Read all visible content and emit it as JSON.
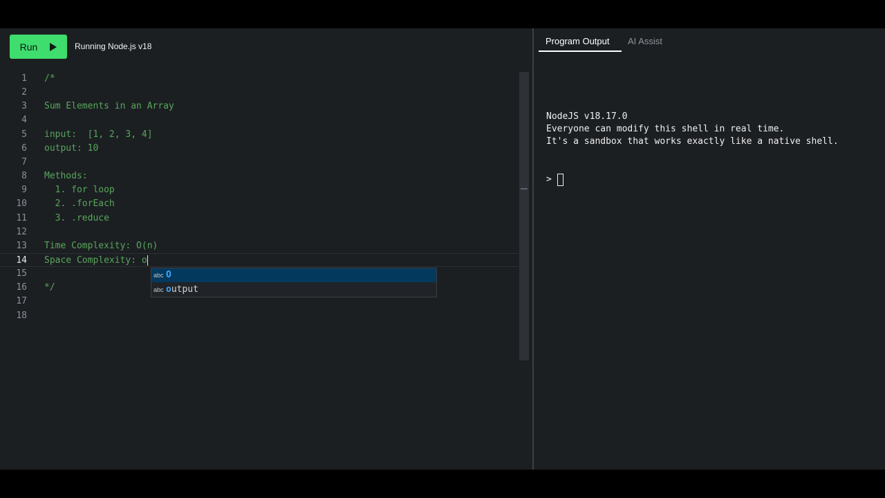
{
  "toolbar": {
    "run_label": "Run",
    "status": "Running Node.js v18"
  },
  "editor": {
    "current_line": 14,
    "lines": [
      {
        "n": "1",
        "text": "/*"
      },
      {
        "n": "2",
        "text": ""
      },
      {
        "n": "3",
        "text": "Sum Elements in an Array"
      },
      {
        "n": "4",
        "text": ""
      },
      {
        "n": "5",
        "text": "input:  [1, 2, 3, 4]"
      },
      {
        "n": "6",
        "text": "output: 10"
      },
      {
        "n": "7",
        "text": ""
      },
      {
        "n": "8",
        "text": "Methods:"
      },
      {
        "n": "9",
        "text": "  1. for loop"
      },
      {
        "n": "10",
        "text": "  2. .forEach"
      },
      {
        "n": "11",
        "text": "  3. .reduce"
      },
      {
        "n": "12",
        "text": ""
      },
      {
        "n": "13",
        "text": "Time Complexity: O(n)"
      },
      {
        "n": "14",
        "text": "Space Complexity: o"
      },
      {
        "n": "15",
        "text": ""
      },
      {
        "n": "16",
        "text": "*/"
      },
      {
        "n": "17",
        "text": ""
      },
      {
        "n": "18",
        "text": ""
      }
    ]
  },
  "suggestions": [
    {
      "kind": "abc",
      "match": "O",
      "rest": "",
      "selected": true
    },
    {
      "kind": "abc",
      "match": "o",
      "rest": "utput",
      "selected": false
    }
  ],
  "tabs": {
    "output": "Program Output",
    "ai": "AI Assist"
  },
  "terminal": {
    "lines": [
      "NodeJS v18.17.0",
      "Everyone can modify this shell in real time.",
      "It's a sandbox that works exactly like a native shell."
    ],
    "prompt": ">"
  },
  "colors": {
    "run_button": "#3fdc6e",
    "comment": "#58a65c",
    "suggest_selected": "#04395e",
    "suggest_match": "#3ea6ff"
  }
}
